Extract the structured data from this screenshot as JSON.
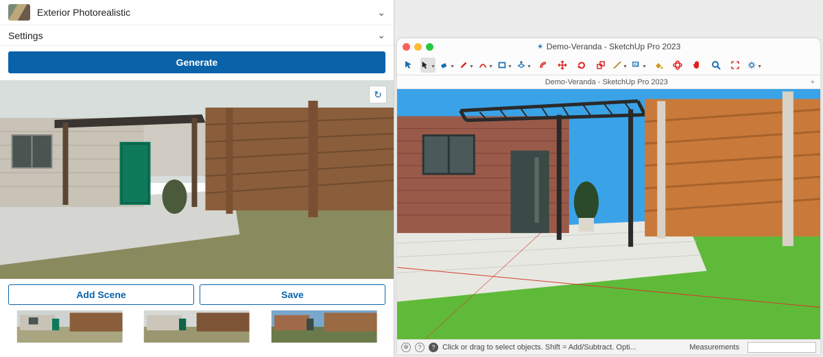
{
  "left": {
    "style_row": {
      "label": "Exterior Photorealistic"
    },
    "settings_row": {
      "label": "Settings"
    },
    "generate_label": "Generate",
    "refresh_tooltip": "Regenerate",
    "add_scene_label": "Add Scene",
    "save_label": "Save"
  },
  "right": {
    "window_title": "Demo-Veranda - SketchUp Pro 2023",
    "tab_title": "Demo-Veranda - SketchUp Pro 2023",
    "status_hint": "Click or drag to select objects. Shift = Add/Subtract. Opti...",
    "measurements_label": "Measurements",
    "toolbar_items": [
      {
        "name": "select-tool",
        "color": "#1a6fb0"
      },
      {
        "name": "cursor-tool",
        "color": "#222",
        "selected": true,
        "dropdown": true
      },
      {
        "name": "eraser-tool",
        "color": "#1a6fb0",
        "dropdown": true
      },
      {
        "name": "pencil-tool",
        "color": "#d22",
        "dropdown": true
      },
      {
        "name": "arc-tool",
        "color": "#d22",
        "dropdown": true
      },
      {
        "name": "rectangle-tool",
        "color": "#1a6fb0",
        "dropdown": true
      },
      {
        "name": "pushpull-tool",
        "color": "#1a6fb0",
        "dropdown": true
      },
      {
        "name": "offset-tool",
        "color": "#d22"
      },
      {
        "name": "move-tool",
        "color": "#d22"
      },
      {
        "name": "rotate-tool",
        "color": "#d22"
      },
      {
        "name": "scale-tool",
        "color": "#d22"
      },
      {
        "name": "tape-tool",
        "color": "#a98a1a",
        "dropdown": true
      },
      {
        "name": "text-tool",
        "color": "#1a6fb0",
        "dropdown": true
      },
      {
        "name": "paint-tool",
        "color": "#d49a1a"
      },
      {
        "name": "orbit-tool",
        "color": "#d22"
      },
      {
        "name": "pan-tool",
        "color": "#d22"
      },
      {
        "name": "zoom-tool",
        "color": "#1a6fb0"
      },
      {
        "name": "zoom-extents-tool",
        "color": "#d22"
      },
      {
        "name": "settings-tool",
        "color": "#1a6fb0",
        "dropdown": true
      }
    ]
  }
}
